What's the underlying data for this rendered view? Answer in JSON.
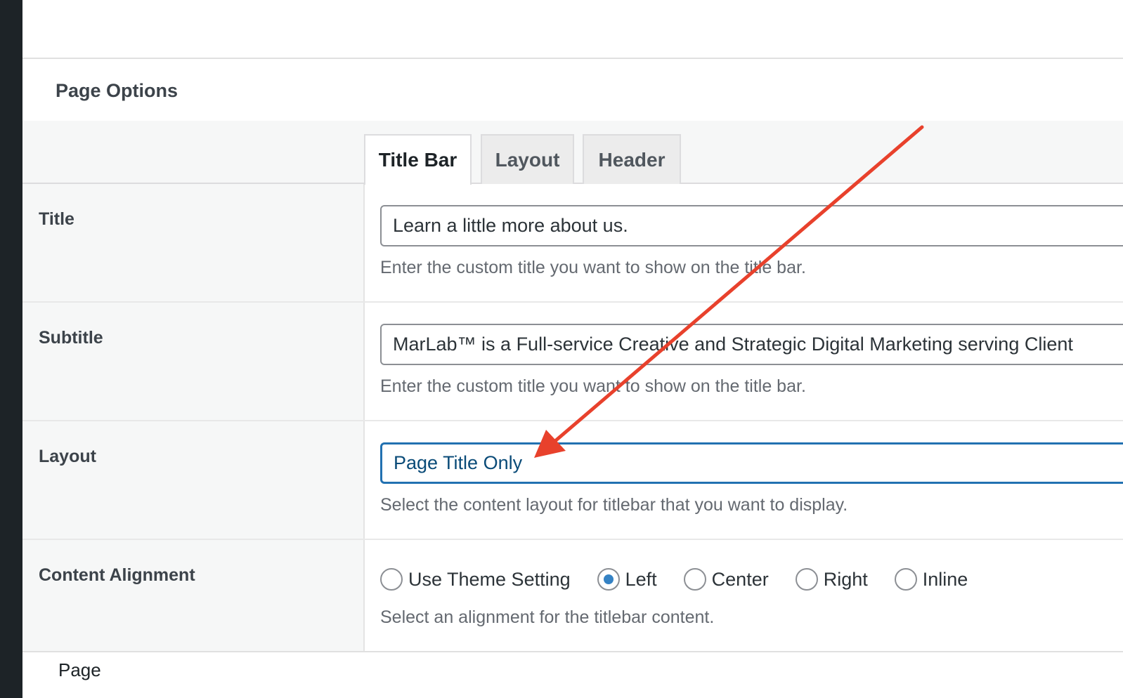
{
  "panel": {
    "title": "Page Options"
  },
  "tabs": [
    {
      "label": "Title Bar",
      "active": true
    },
    {
      "label": "Layout",
      "active": false
    },
    {
      "label": "Header",
      "active": false
    }
  ],
  "fields": {
    "title": {
      "label": "Title",
      "value": "Learn a little more about us.",
      "description": "Enter the custom title you want to show on the title bar."
    },
    "subtitle": {
      "label": "Subtitle",
      "value": "MarLab™ is a Full-service Creative and Strategic Digital Marketing serving Client",
      "description": "Enter the custom title you want to show on the title bar."
    },
    "layout": {
      "label": "Layout",
      "value": "Page Title Only",
      "description": "Select the content layout for titlebar that you want to display."
    },
    "alignment": {
      "label": "Content Alignment",
      "options": [
        "Use Theme Setting",
        "Left",
        "Center",
        "Right",
        "Inline"
      ],
      "selected": "Left",
      "description": "Select an alignment for the titlebar content."
    }
  },
  "footer": {
    "label": "Page"
  },
  "colors": {
    "accent": "#2271b1",
    "radio_checked": "#3582c4",
    "annotation_arrow": "#e8412c",
    "admin_bar": "#1d2327"
  }
}
